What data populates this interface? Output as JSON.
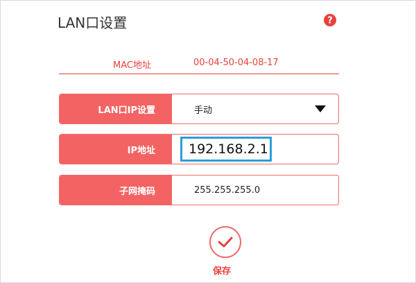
{
  "page": {
    "title": "LAN口设置"
  },
  "mac": {
    "label": "MAC地址",
    "value": "00-04-50-04-08-17"
  },
  "lan_ip_setting": {
    "label": "LAN口IP设置",
    "selected": "手动"
  },
  "ip_address": {
    "label": "IP地址",
    "value": "192.168.2.1"
  },
  "subnet_mask": {
    "label": "子网掩码",
    "value": "255.255.255.0"
  },
  "save": {
    "label": "保存"
  },
  "colors": {
    "accent": "#f36363",
    "accent_text": "#e8413f",
    "focus": "#2a9fd6"
  },
  "icons": {
    "help": "question-circle-icon",
    "save": "checkmark-circle-icon",
    "dropdown": "caret-down-icon"
  }
}
